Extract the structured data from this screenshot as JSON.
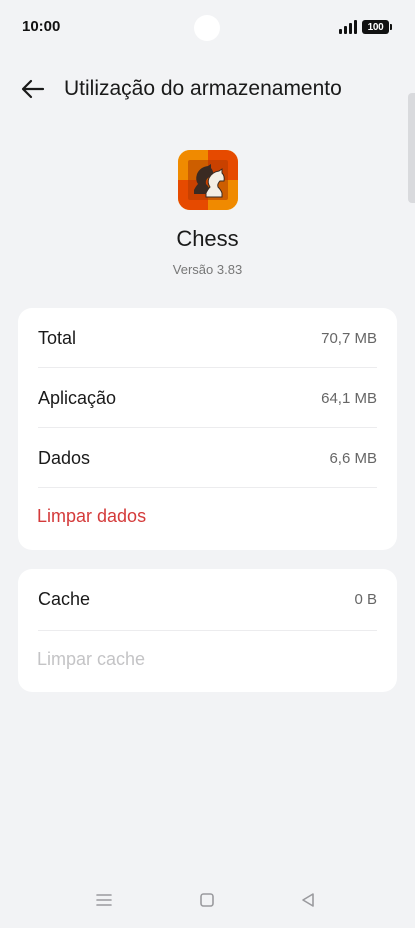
{
  "status_bar": {
    "time": "10:00",
    "battery": "100"
  },
  "header": {
    "title": "Utilização do armazenamento"
  },
  "app": {
    "name": "Chess",
    "version": "Versão 3.83"
  },
  "storage": {
    "rows": [
      {
        "label": "Total",
        "value": "70,7 MB"
      },
      {
        "label": "Aplicação",
        "value": "64,1 MB"
      },
      {
        "label": "Dados",
        "value": "6,6 MB"
      }
    ],
    "clear_data": "Limpar dados"
  },
  "cache": {
    "label": "Cache",
    "value": "0 B",
    "clear_cache": "Limpar cache"
  },
  "colors": {
    "background": "#f2f3f5",
    "danger": "#d43a3a",
    "disabled": "#c4c4c6"
  },
  "icons": [
    "signal-icon",
    "battery-icon",
    "back-arrow-icon",
    "chess-app-icon",
    "menu-nav-icon",
    "home-nav-icon",
    "back-nav-icon"
  ]
}
